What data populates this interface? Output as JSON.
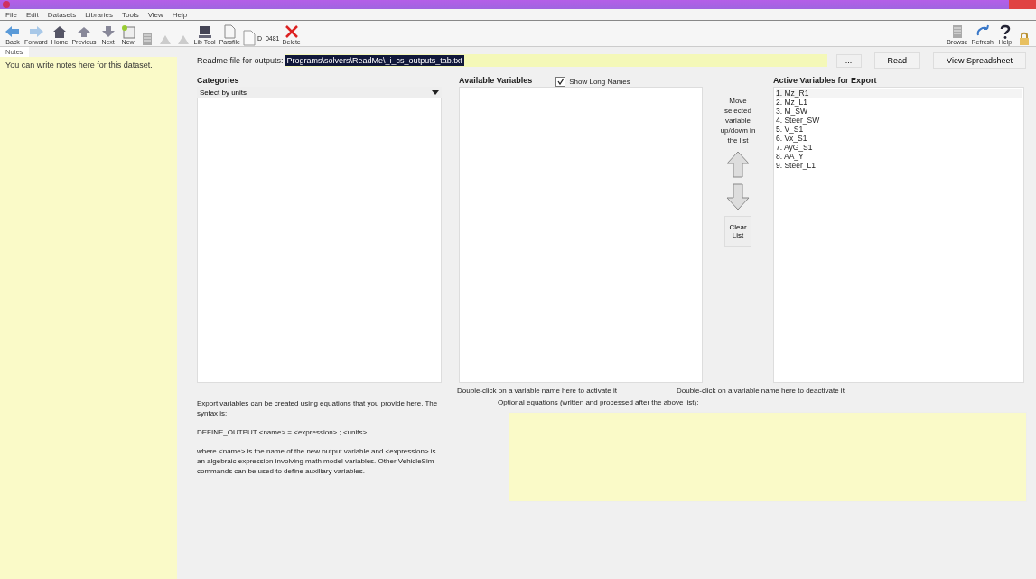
{
  "menu": [
    "File",
    "Edit",
    "Datasets",
    "Libraries",
    "Tools",
    "View",
    "Help"
  ],
  "toolbar": [
    {
      "kind": "back",
      "label": "Back"
    },
    {
      "kind": "forward",
      "label": "Forward"
    },
    {
      "kind": "home",
      "label": "Home"
    },
    {
      "kind": "previous",
      "label": "Previous"
    },
    {
      "kind": "next",
      "label": "Next"
    },
    {
      "kind": "new",
      "label": "New"
    },
    {
      "kind": "sheet"
    },
    {
      "kind": "faded"
    },
    {
      "kind": "faded"
    },
    {
      "kind": "computer",
      "label": "Lib Tool"
    },
    {
      "kind": "page",
      "label": "Parsfile"
    },
    {
      "kind": "dataset",
      "label": "D_0481"
    },
    {
      "kind": "delete",
      "label": "Delete"
    }
  ],
  "toolbar_right": [
    {
      "kind": "sheet",
      "label": "Browse"
    },
    {
      "kind": "refresh",
      "label": "Refresh"
    },
    {
      "kind": "help",
      "label": "Help"
    },
    {
      "kind": "lock"
    }
  ],
  "sidebar": {
    "tabs": [
      {
        "label": "Notes",
        "selected": true
      }
    ],
    "notes": "You can write notes here for this dataset."
  },
  "readme": {
    "label": "Readme file for outputs:",
    "value": "Programs\\solvers\\ReadMe\\_i_cs_outputs_tab.txt",
    "browse": "...",
    "read": "Read",
    "view": "View Spreadsheet"
  },
  "categories": {
    "title": "Categories",
    "dropdown": "Select by units"
  },
  "available": {
    "title": "Available Variables",
    "show_long_names": {
      "label": "Show Long Names",
      "checked": true
    },
    "hint": "Double-click on a variable name here to activate it"
  },
  "move": {
    "text": "Move selected variable up/down in the list",
    "clear": "Clear List"
  },
  "active": {
    "title": "Active Variables for Export",
    "items": [
      {
        "label": "1. Mz_R1",
        "selected": true
      },
      {
        "label": "2. Mz_L1",
        "selected": false
      },
      {
        "label": "3. M_SW",
        "selected": false
      },
      {
        "label": "4. Steer_SW",
        "selected": false
      },
      {
        "label": "5. V_S1",
        "selected": false
      },
      {
        "label": "6. Vx_S1",
        "selected": false
      },
      {
        "label": "7. AyG_S1",
        "selected": false
      },
      {
        "label": "8. AA_Y",
        "selected": false
      },
      {
        "label": "9. Steer_L1",
        "selected": false
      }
    ],
    "hint": "Double-click on a variable name here to deactivate it"
  },
  "help": [
    "Export variables can be created using equations that you provide here. The syntax is:",
    "DEFINE_OUTPUT <name> = <expression> ; <units>",
    "where <name> is the name of the new output variable and <expression> is an algebraic expression involving math model variables. Other VehicleSim commands can be used to define auxiliary variables."
  ],
  "equations": {
    "label": "Optional equations (written and processed after the above list):"
  }
}
